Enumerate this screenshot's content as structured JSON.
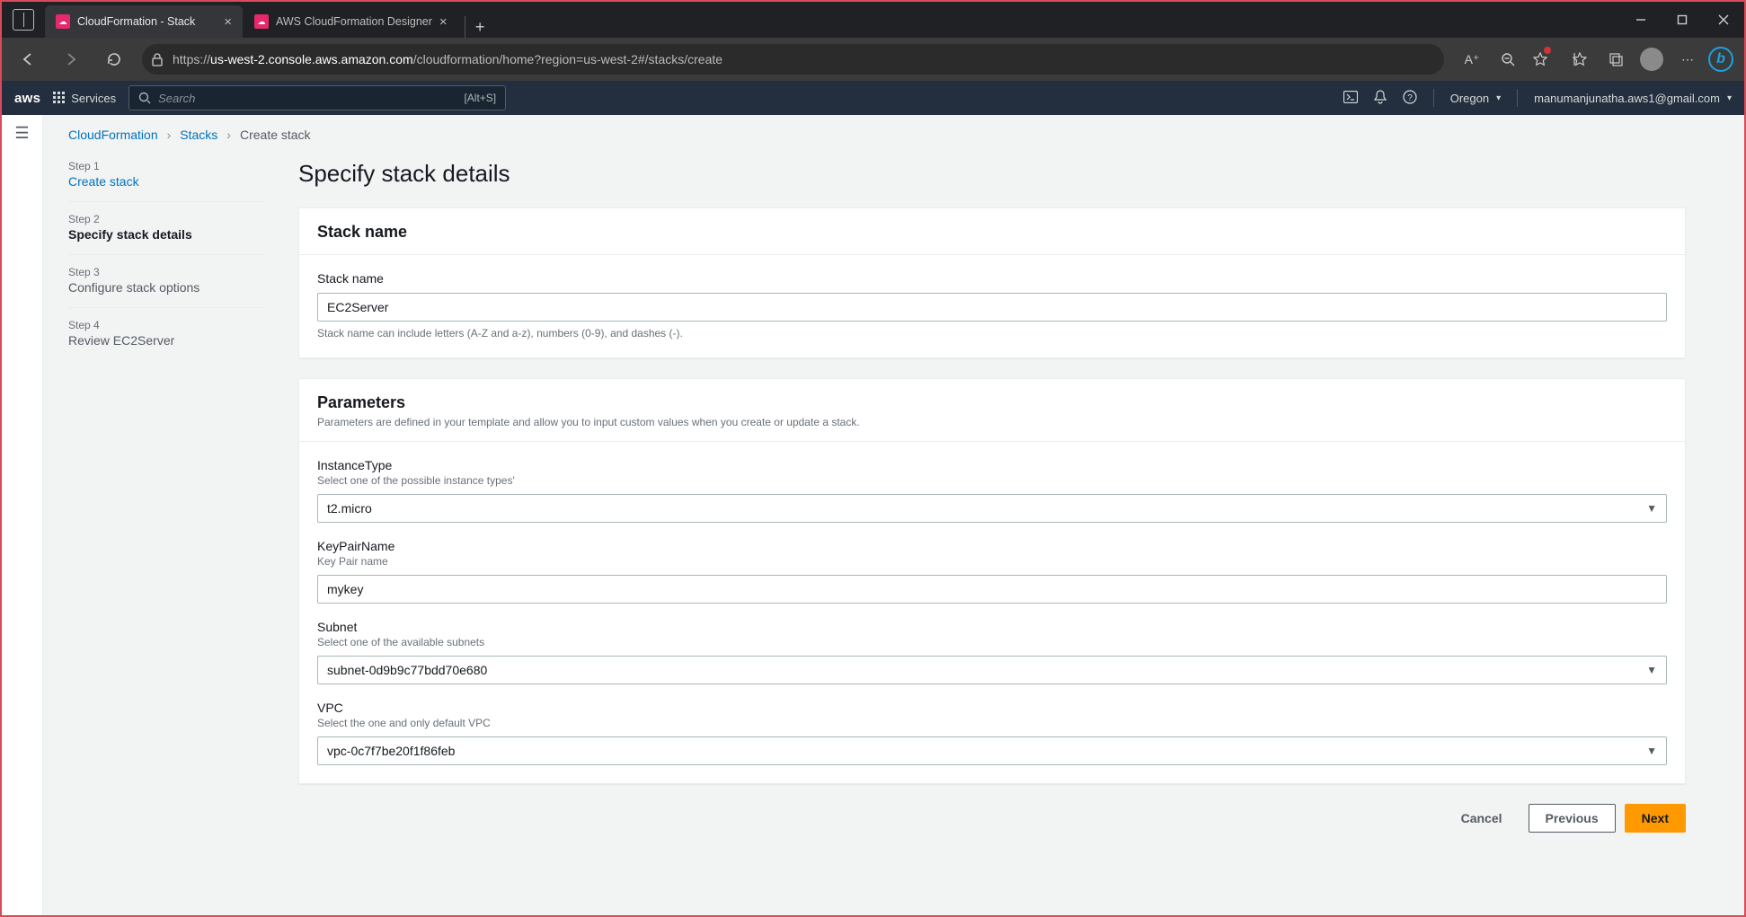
{
  "browser": {
    "tabs": [
      {
        "title": "CloudFormation - Stack",
        "active": true
      },
      {
        "title": "AWS CloudFormation Designer",
        "active": false
      }
    ],
    "url_proto": "https://",
    "url_host": "us-west-2.console.aws.amazon.com",
    "url_path": "/cloudformation/home?region=us-west-2#/stacks/create"
  },
  "aws_nav": {
    "logo": "aws",
    "services": "Services",
    "search_placeholder": "Search",
    "search_hint": "[Alt+S]",
    "region": "Oregon",
    "account": "manumanjunatha.aws1@gmail.com"
  },
  "breadcrumbs": {
    "root": "CloudFormation",
    "mid": "Stacks",
    "current": "Create stack"
  },
  "wizard": {
    "steps": [
      {
        "num": "Step 1",
        "title": "Create stack",
        "state": "done"
      },
      {
        "num": "Step 2",
        "title": "Specify stack details",
        "state": "active"
      },
      {
        "num": "Step 3",
        "title": "Configure stack options",
        "state": ""
      },
      {
        "num": "Step 4",
        "title": "Review EC2Server",
        "state": ""
      }
    ]
  },
  "page": {
    "heading": "Specify stack details",
    "stack_name_panel": {
      "title": "Stack name",
      "field_label": "Stack name",
      "value": "EC2Server",
      "help": "Stack name can include letters (A-Z and a-z), numbers (0-9), and dashes (-)."
    },
    "params_panel": {
      "title": "Parameters",
      "subtitle": "Parameters are defined in your template and allow you to input custom values when you create or update a stack.",
      "fields": {
        "instance_type": {
          "label": "InstanceType",
          "desc": "Select one of the possible instance types'",
          "value": "t2.micro"
        },
        "keypair": {
          "label": "KeyPairName",
          "desc": "Key Pair name",
          "value": "mykey"
        },
        "subnet": {
          "label": "Subnet",
          "desc": "Select one of the available subnets",
          "value": "subnet-0d9b9c77bdd70e680"
        },
        "vpc": {
          "label": "VPC",
          "desc": "Select the one and only default VPC",
          "value": "vpc-0c7f7be20f1f86feb"
        }
      }
    },
    "actions": {
      "cancel": "Cancel",
      "previous": "Previous",
      "next": "Next"
    }
  }
}
